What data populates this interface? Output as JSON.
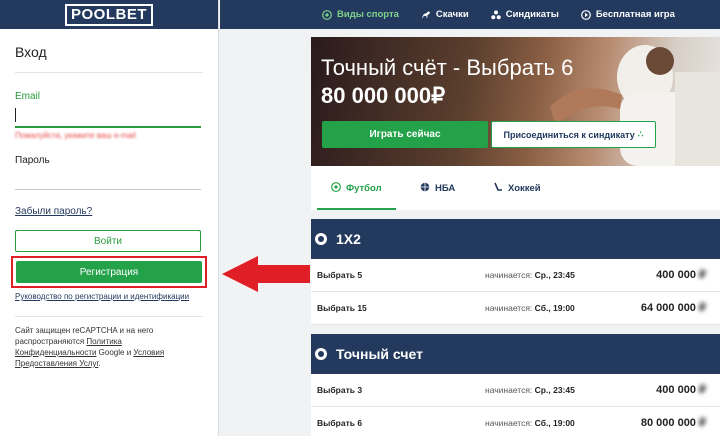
{
  "logo": "POOLBET",
  "login": {
    "title": "Вход",
    "email_label": "Email",
    "email_value": "",
    "email_error": "Пожалуйста, укажите ваш e-mail",
    "password_label": "Пароль",
    "forgot_link": "Забыли пароль?",
    "login_button": "Войти",
    "register_button": "Регистрация",
    "guide_link": "Руководство по регистрации и идентификации",
    "captcha_text_1": "Сайт защищен reCAPTCHA и на него распространяются ",
    "captcha_link_1": "Политика Конфиденциальности",
    "captcha_text_2": " Google и ",
    "captcha_link_2": "Условия Предоставления Услуг",
    "captcha_text_3": "."
  },
  "nav": {
    "items": [
      {
        "label": "Виды спорта",
        "icon": "soccer-ball-icon",
        "active": true
      },
      {
        "label": "Скачки",
        "icon": "horse-icon",
        "active": false
      },
      {
        "label": "Синдикаты",
        "icon": "syndicate-icon",
        "active": false
      },
      {
        "label": "Бесплатная игра",
        "icon": "free-game-icon",
        "active": false
      }
    ]
  },
  "hero": {
    "title": "Точный счёт - Выбрать 6",
    "amount": "80 000 000₽",
    "play_button": "Играть сейчас",
    "join_button": "Присоединиться к синдикату"
  },
  "sport_tabs": [
    {
      "label": "Футбол",
      "icon": "soccer-ball-icon",
      "active": true
    },
    {
      "label": "НБА",
      "icon": "basketball-icon",
      "active": false
    },
    {
      "label": "Хоккей",
      "icon": "hockey-stick-icon",
      "active": false
    }
  ],
  "sections": [
    {
      "title": "1X2",
      "rows": [
        {
          "name": "Выбрать 5",
          "starts_label": "начинается:",
          "starts_time": "Ср., 23:45",
          "prize": "400 000",
          "prize_hidden": "₽"
        },
        {
          "name": "Выбрать 15",
          "starts_label": "начинается:",
          "starts_time": "Сб., 19:00",
          "prize": "64 000 000",
          "prize_hidden": "₽"
        }
      ]
    },
    {
      "title": "Точный счет",
      "rows": [
        {
          "name": "Выбрать 3",
          "starts_label": "начинается:",
          "starts_time": "Ср., 23:45",
          "prize": "400 000",
          "prize_hidden": "₽"
        },
        {
          "name": "Выбрать 6",
          "starts_label": "начинается:",
          "starts_time": "Сб., 19:00",
          "prize": "80 000 000",
          "prize_hidden": "₽"
        }
      ]
    }
  ],
  "colors": {
    "navy": "#233a5e",
    "green": "#23a24a",
    "highlight_red": "#e01e26"
  }
}
